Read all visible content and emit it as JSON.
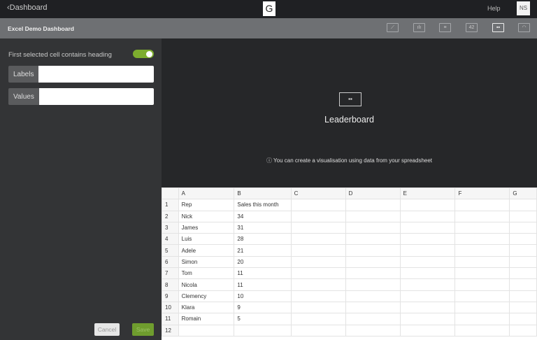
{
  "topbar": {
    "back_label": "Dashboard",
    "logo": "G",
    "help": "Help",
    "avatar": "NS"
  },
  "toolbar": {
    "title": "Excel Demo Dashboard",
    "icons": [
      "line-chart",
      "bar-chart",
      "text",
      "number",
      "leaderboard",
      "gauge"
    ],
    "icon_glyphs": [
      "⟋",
      "ılı",
      "≡",
      "42",
      "▪▪",
      "◠"
    ]
  },
  "panel": {
    "heading_toggle_label": "First selected cell contains heading",
    "heading_toggle_on": true,
    "labels_label": "Labels",
    "labels_value": "",
    "values_label": "Values",
    "values_value": "",
    "cancel": "Cancel",
    "save": "Save"
  },
  "preview": {
    "icon": "▪▪",
    "title": "Leaderboard",
    "info": "ⓘ You can create a visualisation using data from your spreadsheet"
  },
  "sheet": {
    "columns": [
      "A",
      "B",
      "C",
      "D",
      "E",
      "F",
      "G"
    ],
    "rows": [
      [
        "1",
        "Rep",
        "Sales this month"
      ],
      [
        "2",
        "Nick",
        "34"
      ],
      [
        "3",
        "James",
        "31"
      ],
      [
        "4",
        "Luis",
        "28"
      ],
      [
        "5",
        "Adele",
        "21"
      ],
      [
        "6",
        "Simon",
        "20"
      ],
      [
        "7",
        "Tom",
        "11"
      ],
      [
        "8",
        "Nicola",
        "11"
      ],
      [
        "9",
        "Clemency",
        "10"
      ],
      [
        "10",
        "Klara",
        "9"
      ],
      [
        "11",
        "Romain",
        "5"
      ],
      [
        "12",
        "",
        ""
      ]
    ]
  },
  "colors": {
    "accent": "#7dad2e"
  }
}
